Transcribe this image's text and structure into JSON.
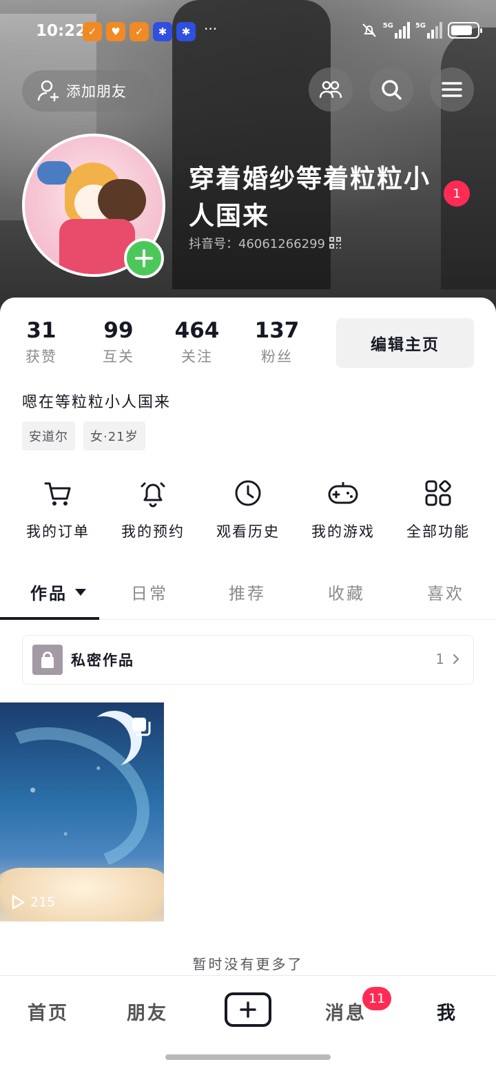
{
  "status_bar": {
    "time": "10:22",
    "more": "···",
    "signal_label_1": "5G",
    "signal_label_2": "5G"
  },
  "header": {
    "add_friend_label": "添加朋友",
    "username": "穿着婚纱等着粒粒小人国来",
    "douyin_id": "抖音号：46061266299",
    "notification_badge": "1"
  },
  "stats": [
    {
      "value": "31",
      "label": "获赞"
    },
    {
      "value": "99",
      "label": "互关"
    },
    {
      "value": "464",
      "label": "关注"
    },
    {
      "value": "137",
      "label": "粉丝"
    }
  ],
  "edit_button_label": "编辑主页",
  "bio": "嗯在等粒粒小人国来",
  "tags": [
    "安道尔",
    "女·21岁"
  ],
  "features": [
    {
      "label": "我的订单",
      "icon": "cart-icon"
    },
    {
      "label": "我的预约",
      "icon": "bell-icon"
    },
    {
      "label": "观看历史",
      "icon": "clock-icon"
    },
    {
      "label": "我的游戏",
      "icon": "gamepad-icon"
    },
    {
      "label": "全部功能",
      "icon": "grid-icon"
    }
  ],
  "tabs": [
    {
      "label": "作品",
      "active": true
    },
    {
      "label": "日常",
      "active": false
    },
    {
      "label": "推荐",
      "active": false
    },
    {
      "label": "收藏",
      "active": false
    },
    {
      "label": "喜欢",
      "active": false
    }
  ],
  "private_works": {
    "label": "私密作品",
    "count": "1"
  },
  "video": {
    "play_count": "215"
  },
  "no_more_text": "暂时没有更多了",
  "bottom_nav": {
    "home": "首页",
    "friends": "朋友",
    "messages": "消息",
    "messages_badge": "11",
    "me": "我"
  },
  "colors": {
    "accent_red": "#fe2c55",
    "plus_green": "#4cc85a",
    "text_primary": "#161823",
    "text_secondary": "#8a8b91"
  }
}
